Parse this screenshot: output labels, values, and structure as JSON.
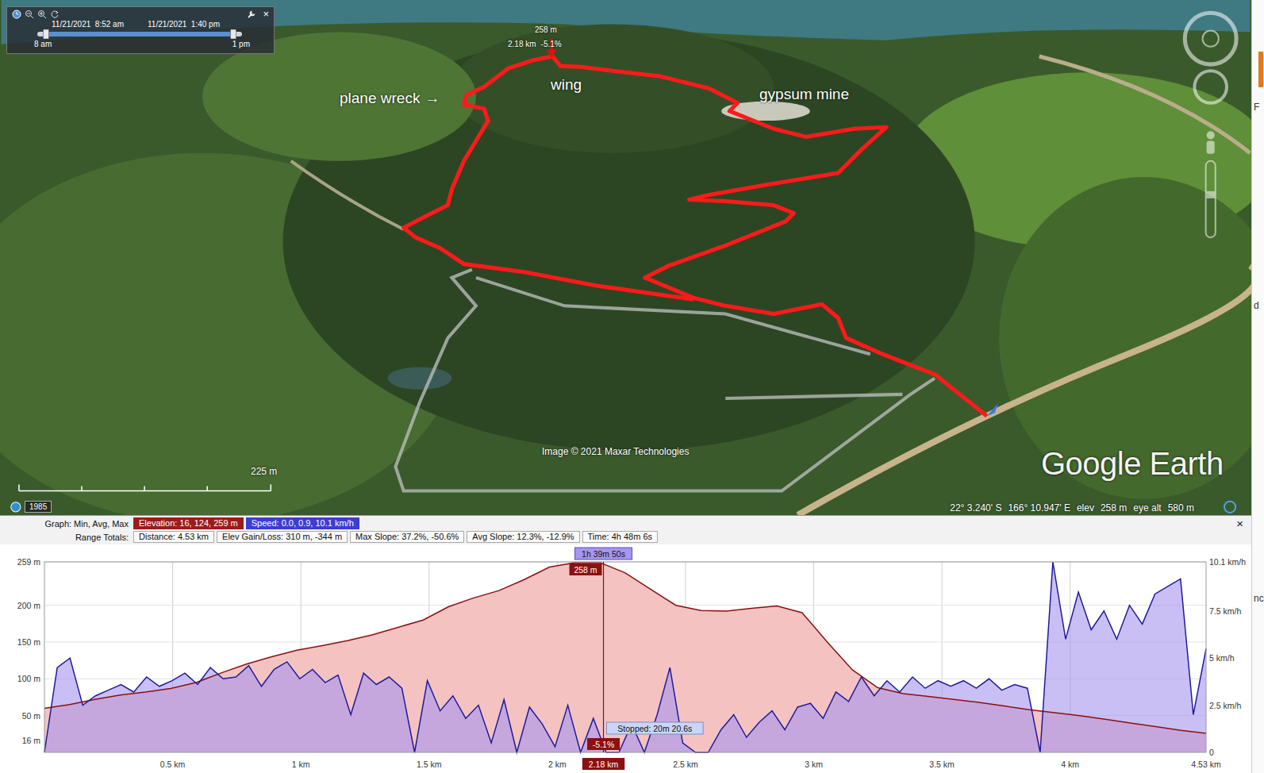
{
  "time_slider": {
    "start": "11/21/2021  8:52 am",
    "end": "11/21/2021  1:40 pm",
    "min_label": "8 am",
    "max_label": "1 pm",
    "range": [
      0.03,
      0.97
    ],
    "close": "×"
  },
  "map": {
    "cursor": {
      "elevation": "258 m",
      "distance": "2.18 km",
      "slope": "-5.1%"
    },
    "annotations": [
      {
        "text": "plane wreck",
        "arrow": "→"
      },
      {
        "text": "wing",
        "arrow": ""
      },
      {
        "text": "gypsum mine",
        "arrow": ""
      }
    ],
    "attribution": "Image © 2021 Maxar Technologies",
    "logo": "Google Earth",
    "scale": "225 m",
    "history_year": "1985",
    "status": [
      "22° 3.240' S",
      "166° 10.947' E",
      "elev",
      "258 m",
      "eye alt",
      "580 m"
    ]
  },
  "graph": {
    "close": "×",
    "min_avg_max": {
      "label": "Graph: Min, Avg, Max",
      "items": [
        {
          "text": "Elevation: 16, 124, 259 m",
          "color": "#9e1b1b"
        },
        {
          "text": "Speed: 0.0, 0.9, 10.1 km/h",
          "color": "#3d3dd4"
        }
      ]
    },
    "range_totals": {
      "label": "Range Totals:",
      "items": [
        "Distance: 4.53 km",
        "Elev Gain/Loss: 310 m, -344 m",
        "Max Slope: 37.2%, -50.6%",
        "Avg Slope: 12.3%, -12.9%",
        "Time: 4h 48m 6s"
      ]
    },
    "x_axis": {
      "min": 0,
      "max": 4.53,
      "ticks": [
        {
          "label": "0.5 km",
          "value": 0.5
        },
        {
          "label": "1 km",
          "value": 1
        },
        {
          "label": "1.5 km",
          "value": 1.5
        },
        {
          "label": "2 km",
          "value": 2
        },
        {
          "label": "2.5 km",
          "value": 2.5
        },
        {
          "label": "3 km",
          "value": 3
        },
        {
          "label": "3.5 km",
          "value": 3.5
        },
        {
          "label": "4 km",
          "value": 4
        },
        {
          "label": "4.53 km",
          "value": 4.53
        }
      ]
    },
    "elevation_axis": {
      "min": 0,
      "max": 259,
      "ticks": [
        {
          "label": "259 m",
          "value": 259
        },
        {
          "label": "200 m",
          "value": 200
        },
        {
          "label": "150 m",
          "value": 150
        },
        {
          "label": "100 m",
          "value": 100
        },
        {
          "label": "50 m",
          "value": 50
        },
        {
          "label": "16 m",
          "value": 16
        }
      ]
    },
    "speed_axis": {
      "min": 0,
      "max": 10.1,
      "ticks": [
        {
          "label": "10.1 km/h",
          "value": 10.1
        },
        {
          "label": "7.5 km/h",
          "value": 7.5
        },
        {
          "label": "5 km/h",
          "value": 5
        },
        {
          "label": "2.5 km/h",
          "value": 2.5
        },
        {
          "label": "0",
          "value": 0
        }
      ]
    },
    "elevation": {
      "color": "#8b1010",
      "fill": "#f5c2c2",
      "values": [
        60,
        65,
        72,
        78,
        82,
        87,
        95,
        108,
        120,
        130,
        139,
        145,
        152,
        160,
        170,
        180,
        198,
        210,
        220,
        235,
        252,
        258,
        258,
        244,
        222,
        200,
        193,
        192,
        196,
        199,
        190,
        150,
        112,
        88,
        80,
        76,
        72,
        68,
        63,
        58,
        54,
        50,
        45,
        40,
        35,
        30,
        26
      ]
    },
    "speed": {
      "color": "#1c1c9c",
      "fill": "#a795ee",
      "values": [
        0,
        4.5,
        5,
        2.5,
        3,
        3.3,
        3.6,
        3.2,
        4,
        3.5,
        3.8,
        4.2,
        3.6,
        4.5,
        3.9,
        4,
        4.6,
        3.5,
        4.4,
        4.8,
        3.9,
        4.4,
        3.7,
        4.1,
        2,
        4.2,
        3.6,
        4,
        3.4,
        0,
        3.8,
        2.2,
        3,
        1.8,
        2.5,
        0.5,
        2.8,
        0,
        2.4,
        1.5,
        0.3,
        2.5,
        0,
        1.8,
        0,
        0,
        1.5,
        0,
        2,
        4.5,
        0.5,
        0,
        0,
        1.2,
        2,
        0.8,
        1.6,
        2.2,
        1.2,
        2.4,
        2.6,
        1.8,
        3.2,
        2.7,
        4,
        3,
        3.8,
        3.2,
        4,
        3.4,
        3.8,
        3.5,
        3.8,
        3.4,
        3.9,
        3.3,
        3.6,
        3.4,
        0,
        10.1,
        6,
        8.5,
        6.5,
        7.5,
        6,
        7.8,
        6.8,
        8.4,
        8.8,
        9.2,
        2,
        5.5
      ]
    },
    "cursor": {
      "position": 2.18,
      "time": "1h 39m 50s",
      "elevation": "258 m",
      "distance": "2.18 km",
      "slope": "-5.1%",
      "stopped": "Stopped: 20m 20.6s"
    }
  },
  "edge_fragments": [
    "F",
    "d",
    "nc"
  ]
}
